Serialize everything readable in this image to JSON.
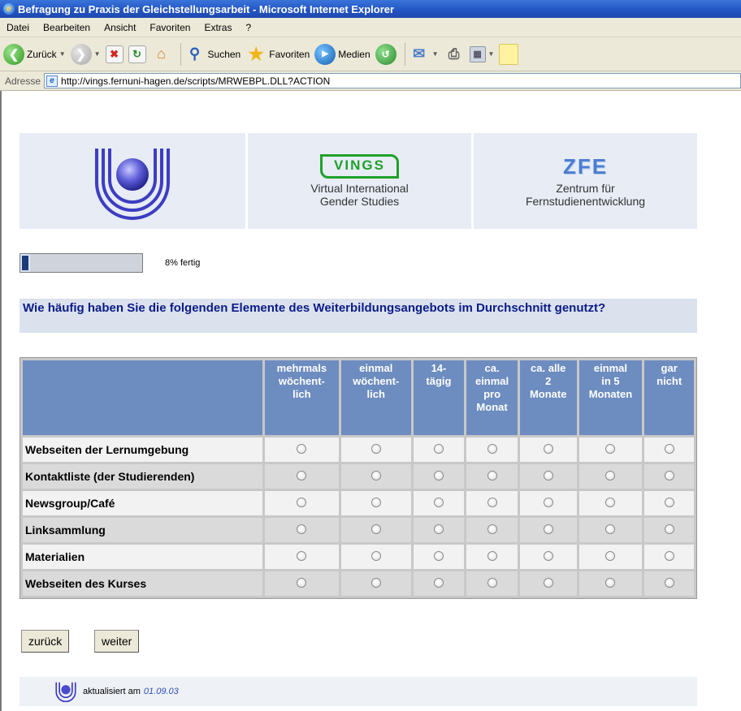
{
  "window": {
    "title": "Befragung zu Praxis der Gleichstellungsarbeit - Microsoft Internet Explorer"
  },
  "menu": [
    "Datei",
    "Bearbeiten",
    "Ansicht",
    "Favoriten",
    "Extras",
    "?"
  ],
  "toolbar": {
    "back": "Zurück",
    "search": "Suchen",
    "favorites": "Favoriten",
    "media": "Medien"
  },
  "address": {
    "label": "Adresse",
    "url": "http://vings.fernuni-hagen.de/scripts/MRWEBPL.DLL?ACTION"
  },
  "header": {
    "vings_logo": "VINGS",
    "vings_line1": "Virtual International",
    "vings_line2": "Gender Studies",
    "zfe_logo": "ZFE",
    "zfe_line1": "Zentrum für",
    "zfe_line2": "Fernstudienentwicklung"
  },
  "progress": {
    "percent": 8,
    "label": "8% fertig"
  },
  "question": "Wie häufig haben Sie die folgenden Elemente des Weiterbildungsangebots im Durchschnitt genutzt?",
  "columns": [
    [
      "mehrmals",
      "wöchent-",
      "lich"
    ],
    [
      "einmal",
      "wöchent-",
      "lich"
    ],
    [
      "14-",
      "tägig"
    ],
    [
      "ca.",
      "einmal",
      "pro",
      "Monat"
    ],
    [
      "ca. alle",
      "2",
      "Monate"
    ],
    [
      "einmal",
      "in 5",
      "Monaten"
    ],
    [
      "gar",
      "nicht"
    ]
  ],
  "rows": [
    "Webseiten der Lernumgebung",
    "Kontaktliste (der Studierenden)",
    "Newsgroup/Café",
    "Linksammlung",
    "Materialien",
    "Webseiten des Kurses"
  ],
  "buttons": {
    "back": "zurück",
    "next": "weiter"
  },
  "footer": {
    "text": "aktualisiert am",
    "date": "01.09.03"
  },
  "colors": {
    "header_cell": "#6d8cbf",
    "question_text": "#0b1b87",
    "progress_fill": "#1b3a7a"
  }
}
